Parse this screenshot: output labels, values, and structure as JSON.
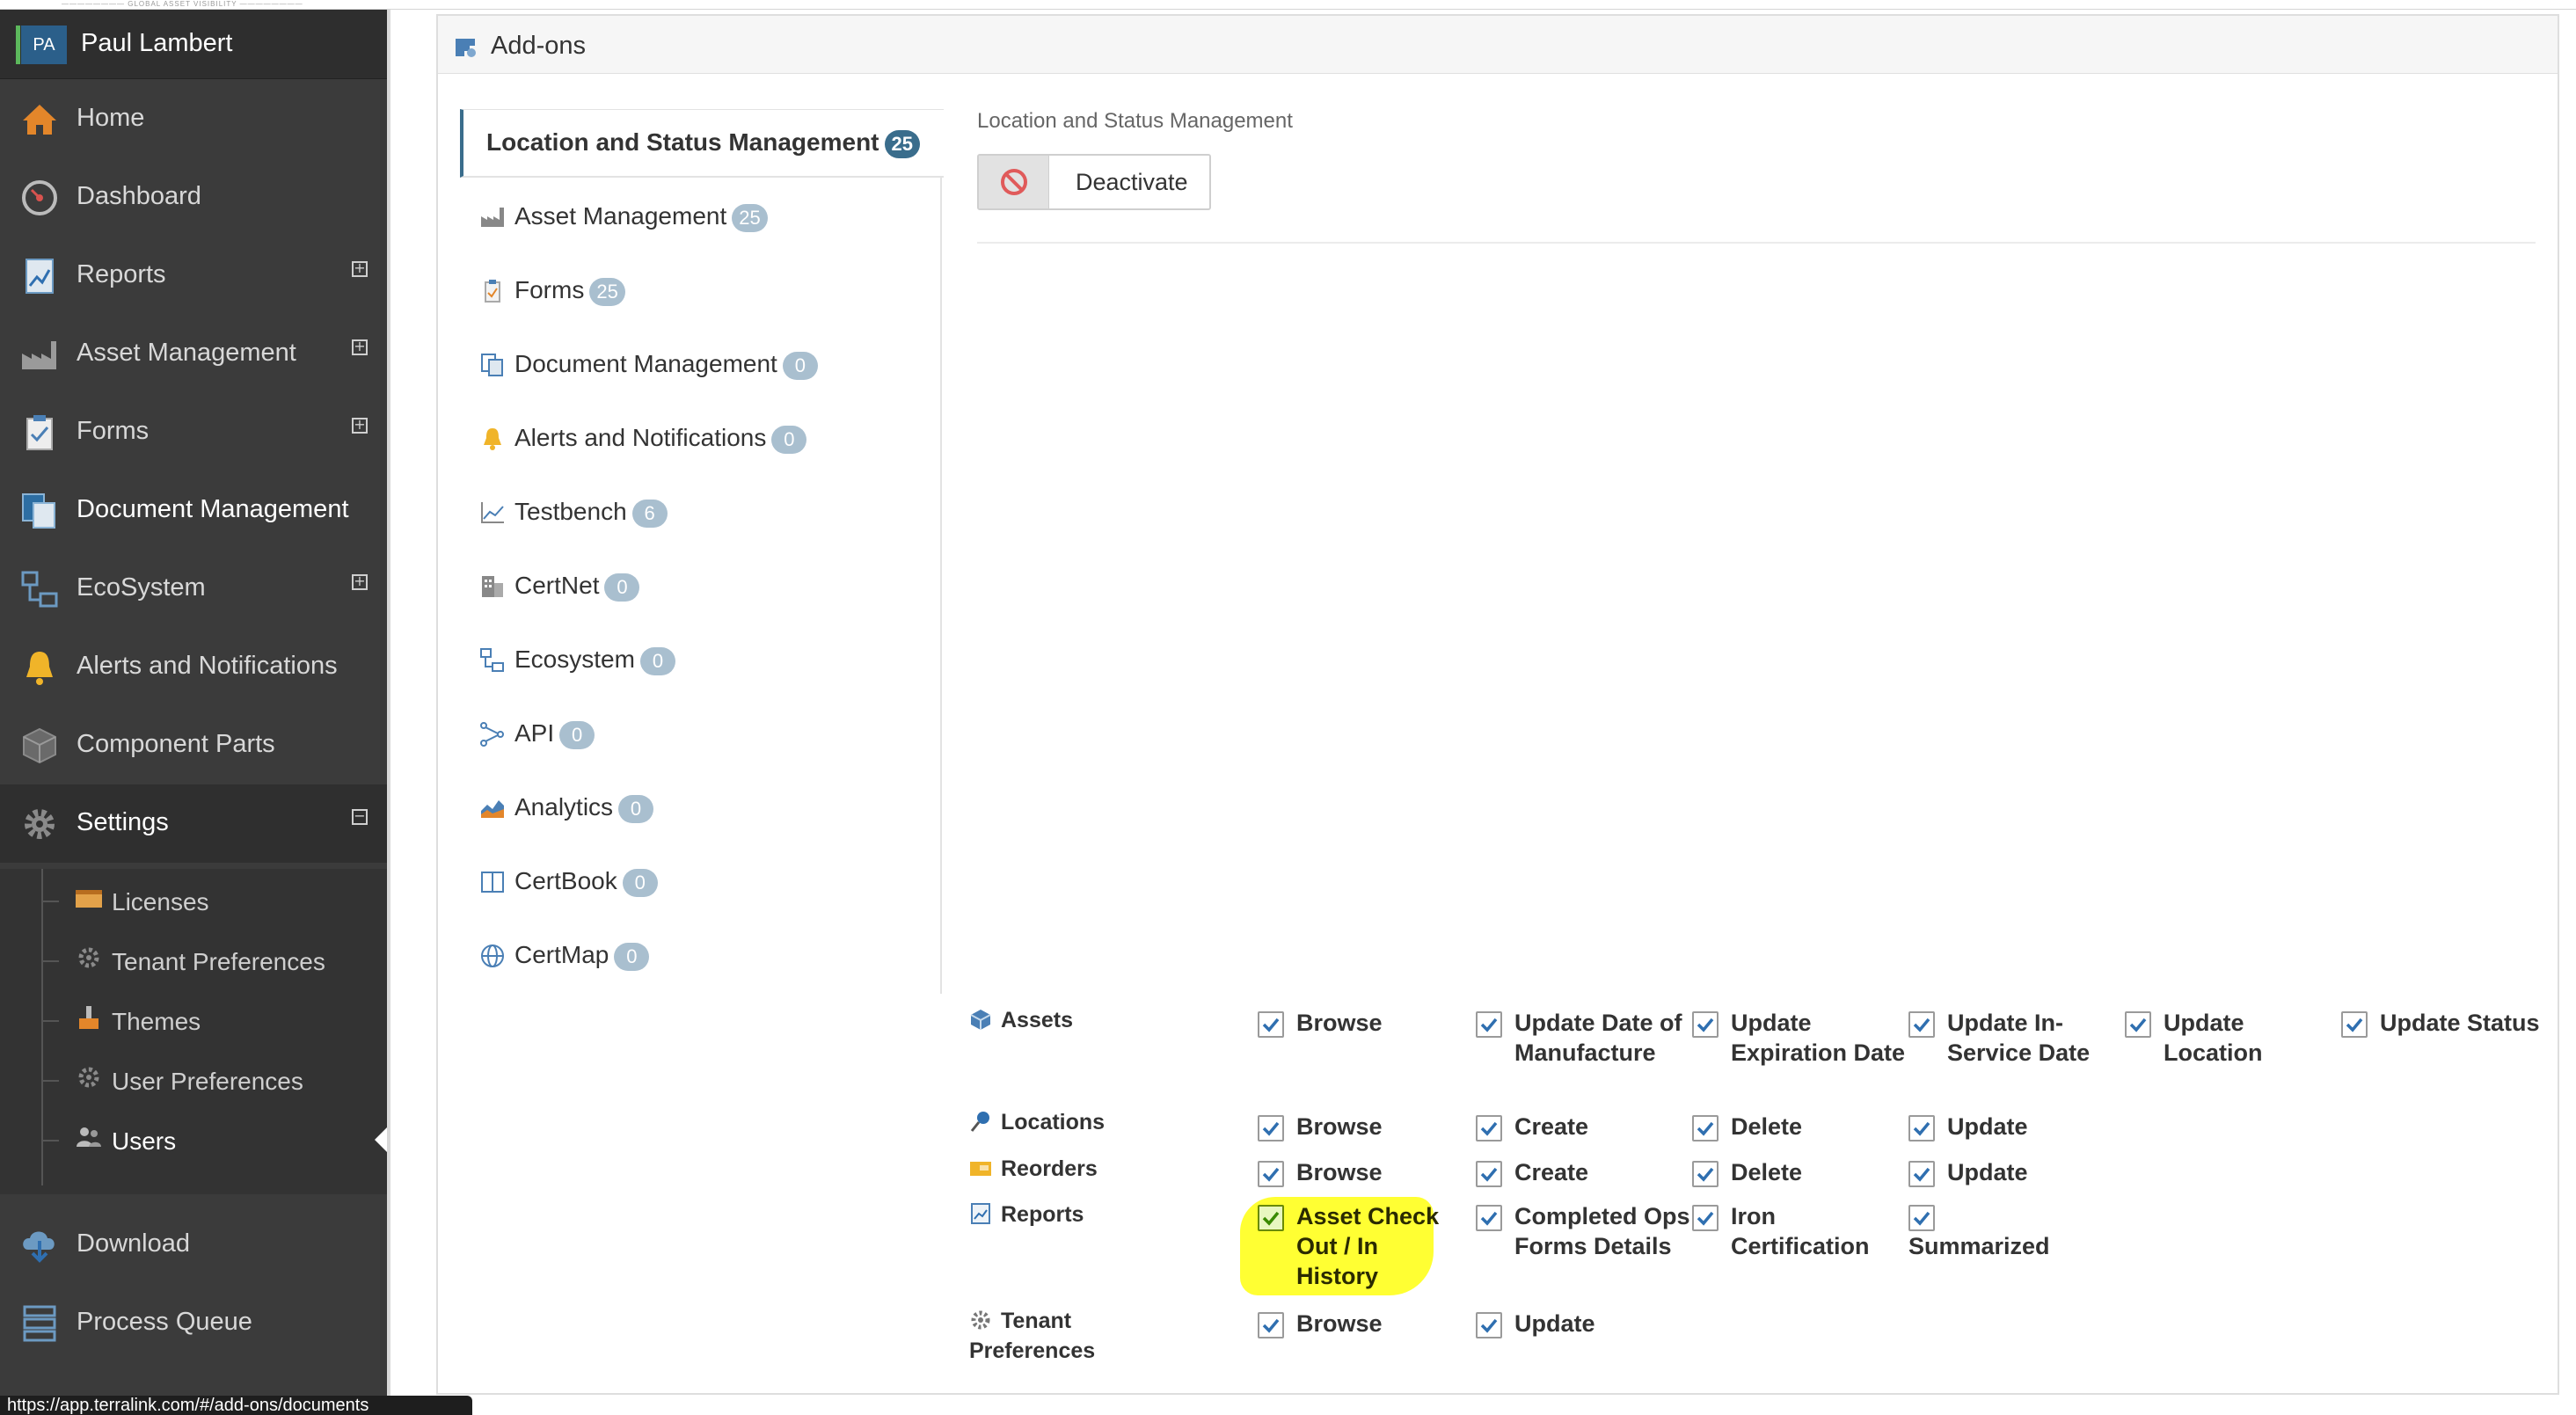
{
  "user": {
    "initials": "PA",
    "name": "Paul Lambert"
  },
  "nav": [
    {
      "label": "Home",
      "icon": "home-icon",
      "expandable": false
    },
    {
      "label": "Dashboard",
      "icon": "speedometer-icon",
      "expandable": false
    },
    {
      "label": "Reports",
      "icon": "report-icon",
      "expandable": true
    },
    {
      "label": "Asset Management",
      "icon": "factory-icon",
      "expandable": true
    },
    {
      "label": "Forms",
      "icon": "clipboard-icon",
      "expandable": true
    },
    {
      "label": "Document Management",
      "icon": "document-icon",
      "expandable": false
    },
    {
      "label": "EcoSystem",
      "icon": "network-icon",
      "expandable": true
    },
    {
      "label": "Alerts and Notifications",
      "icon": "bell-icon",
      "expandable": false
    },
    {
      "label": "Component Parts",
      "icon": "cube-icon",
      "expandable": false
    },
    {
      "label": "Settings",
      "icon": "gear-icon",
      "expandable": true
    }
  ],
  "settings_sub": [
    {
      "label": "Licenses",
      "icon": "license-icon"
    },
    {
      "label": "Tenant Preferences",
      "icon": "gear-icon"
    },
    {
      "label": "Themes",
      "icon": "paint-icon"
    },
    {
      "label": "User Preferences",
      "icon": "gear-icon"
    },
    {
      "label": "Users",
      "icon": "users-icon"
    }
  ],
  "nav_bottom": [
    {
      "label": "Download",
      "icon": "download-icon"
    },
    {
      "label": "Process Queue",
      "icon": "queue-icon"
    }
  ],
  "status_url": "https://app.terralink.com/#/add-ons/documents",
  "panel": {
    "title": "Add-ons"
  },
  "tabs": {
    "active": {
      "label": "Location and Status Management",
      "count": "25"
    },
    "items": [
      {
        "label": "Asset Management",
        "count": "25"
      },
      {
        "label": "Forms",
        "count": "25"
      },
      {
        "label": "Document Management",
        "count": "0"
      },
      {
        "label": "Alerts and Notifications",
        "count": "0"
      },
      {
        "label": "Testbench",
        "count": "6"
      },
      {
        "label": "CertNet",
        "count": "0"
      },
      {
        "label": "Ecosystem",
        "count": "0"
      },
      {
        "label": "API",
        "count": "0"
      },
      {
        "label": "Analytics",
        "count": "0"
      },
      {
        "label": "CertBook",
        "count": "0"
      },
      {
        "label": "CertMap",
        "count": "0"
      }
    ]
  },
  "content": {
    "title": "Location and Status Management",
    "deactivate_label": "Deactivate"
  },
  "permissions": [
    {
      "resource": "Assets",
      "icon": "cube-icon",
      "actions": [
        "Browse",
        "Update Date of Manufacture",
        "Update Expiration Date",
        "Update In-Service Date",
        "Update Location",
        "Update Status"
      ]
    },
    {
      "resource": "Locations",
      "icon": "pin-icon",
      "actions": [
        "Browse",
        "Create",
        "Delete",
        "Update"
      ]
    },
    {
      "resource": "Reorders",
      "icon": "box-icon",
      "actions": [
        "Browse",
        "Create",
        "Delete",
        "Update"
      ]
    },
    {
      "resource": "Reports",
      "icon": "report-icon",
      "actions": [
        "Asset Check Out / In History",
        "Completed Ops Forms Details",
        "Iron Certification",
        "Summarized"
      ]
    },
    {
      "resource": "Tenant Preferences",
      "icon": "gear-icon",
      "actions": [
        "Browse",
        "Update"
      ]
    }
  ],
  "colors": {
    "sidebar": "#3b3b3b",
    "accent": "#3a6d8c",
    "badge": "#a9bfcf",
    "checkbox": "#2f6fb0",
    "highlight": "#ffff33"
  }
}
